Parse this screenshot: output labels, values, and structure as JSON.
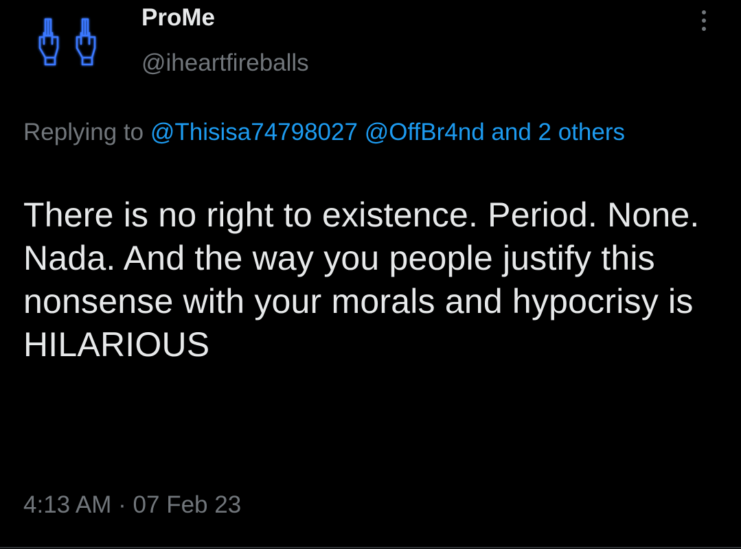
{
  "tweet": {
    "author": {
      "display_name": "ProMe",
      "handle": "@iheartfireballs",
      "avatar_icon": "neon-hands-icon"
    },
    "more_icon": "more-vertical-icon",
    "reply": {
      "prefix": "Replying to",
      "mention_1": "@Thisisa74798027",
      "mention_2": "@OffBr4nd",
      "others": "and 2 others"
    },
    "text": "There is no right to existence. Period. None. Nada. And the way you people justify this nonsense with your morals and hypocrisy is HILARIOUS",
    "time": "4:13 AM",
    "separator": "·",
    "date": "07 Feb 23"
  },
  "colors": {
    "background": "#000000",
    "primary_text": "#e7e9ea",
    "secondary_text": "#71767b",
    "link": "#1d9bf0",
    "avatar_glow": "#2f6bff"
  }
}
